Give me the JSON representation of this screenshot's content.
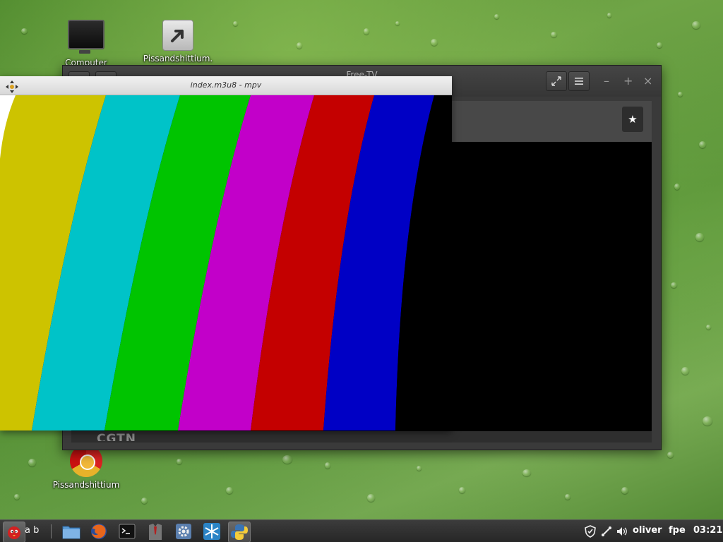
{
  "desktop": {
    "icons": [
      {
        "label": "Computer",
        "icon": "monitor-icon"
      },
      {
        "label": "Pissandshittium.",
        "icon": "shortcut-arrow-icon"
      },
      {
        "label": "Pissandshittium",
        "icon": "browser-icon"
      }
    ]
  },
  "tv_window": {
    "title": "Free-TV",
    "fullscreen_icon": "expand-icon",
    "menu_icon": "hamburger-menu-icon",
    "minimize": "–",
    "maximize": "+",
    "close": "×",
    "favorite_icon": "★",
    "channel_label": "CGTN"
  },
  "mpv_window": {
    "title": "index.m3u8 - mpv",
    "move_icon": "move-arrows-icon",
    "test_pattern": [
      "#cdc300",
      "#00c3c8",
      "#00c400",
      "#c200c9",
      "#c40000",
      "#0000c5",
      "#000000"
    ]
  },
  "taskbar": {
    "workspace_label": "a b",
    "launchers": [
      {
        "name": "menu",
        "icon": "angry-bird-menu-icon"
      },
      {
        "name": "files",
        "icon": "folder-icon"
      },
      {
        "name": "firefox",
        "icon": "firefox-icon"
      },
      {
        "name": "terminal",
        "icon": "terminal-icon"
      },
      {
        "name": "suit",
        "icon": "suit-icon"
      },
      {
        "name": "settings",
        "icon": "gear-icon"
      },
      {
        "name": "snowflake",
        "icon": "snowflake-icon"
      },
      {
        "name": "python",
        "icon": "python-icon"
      }
    ],
    "tray": {
      "user": "oliver",
      "keyboard": "fpe",
      "clock": "03:21"
    }
  }
}
